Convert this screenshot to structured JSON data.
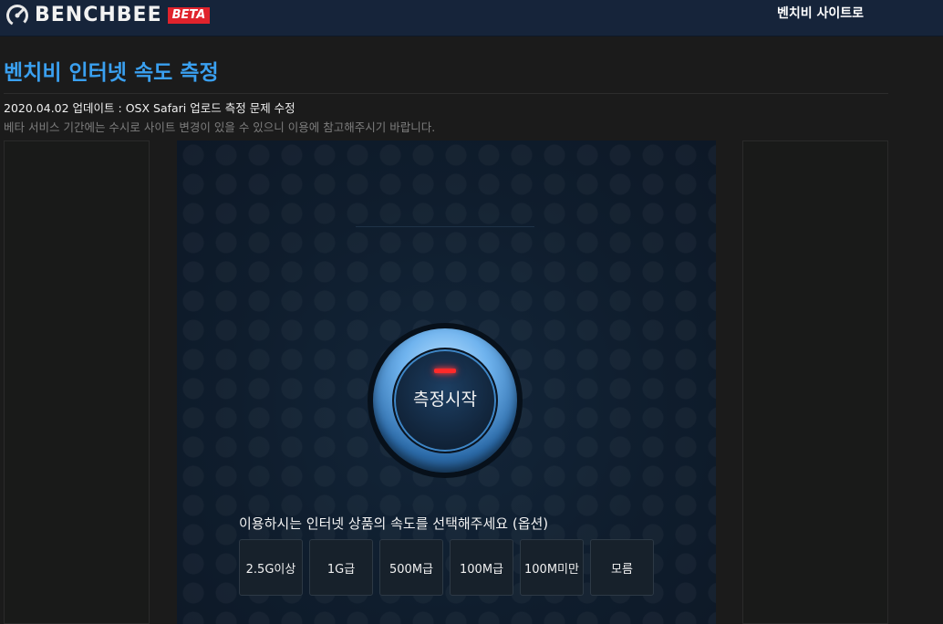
{
  "header": {
    "logo_text": "BENCHBEE",
    "beta_badge": "BETA",
    "site_link": "벤치비 사이트로"
  },
  "page": {
    "title": "벤치비 인터넷 속도 측정",
    "update_note": "2020.04.02 업데이트 : OSX Safari 업로드 측정 문제 수정",
    "beta_note": "베타 서비스 기간에는 수시로 사이트 변경이 있을 수 있으니 이용에 참고해주시기 바랍니다."
  },
  "tester": {
    "start_label": "측정시작",
    "prompt": "이용하시는 인터넷 상품의 속도를 선택해주세요 (옵션)",
    "options": [
      "2.5G이상",
      "1G급",
      "500M급",
      "100M급",
      "100M미만",
      "모름"
    ]
  },
  "colors": {
    "accent": "#3aa0f0",
    "beta": "#e0232c",
    "header_bg": "#16243a",
    "page_bg": "#1b1b1b",
    "led": "#ff2a2a"
  },
  "icons": {
    "logo": "speedometer-icon"
  }
}
